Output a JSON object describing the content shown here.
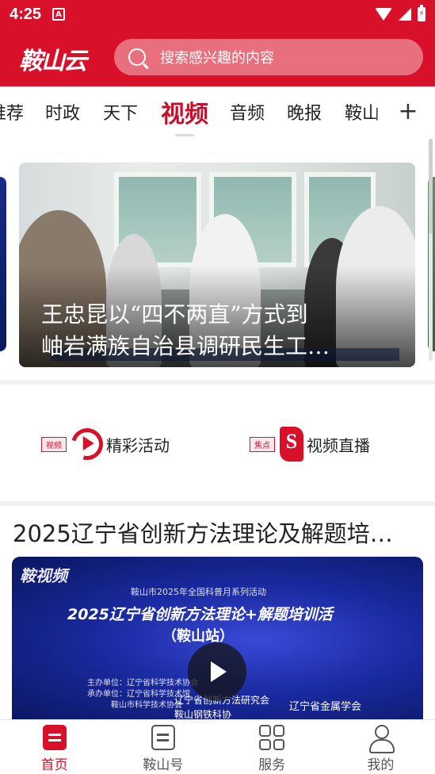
{
  "status_bar": {
    "time": "4:25"
  },
  "header": {
    "logo": "鞍山云",
    "search_placeholder": "搜索感兴趣的内容"
  },
  "tabs": [
    {
      "label": "推荐"
    },
    {
      "label": "时政"
    },
    {
      "label": "天下"
    },
    {
      "label": "视频"
    },
    {
      "label": "音频"
    },
    {
      "label": "晚报"
    },
    {
      "label": "鞍山"
    }
  ],
  "tab_more": "+",
  "hero": {
    "title_line1": "王忠昆以“四不两直”方式到",
    "title_line2": "岫岩满族自治县调研民生工…"
  },
  "quick_entries": [
    {
      "tag": "视频",
      "label": "精彩活动"
    },
    {
      "tag": "焦点",
      "label": "视频直播"
    }
  ],
  "article": {
    "title": "2025辽宁省创新方法理论及解题培…",
    "brand": "鞍视频",
    "poster_lines": [
      "鞍山市2025年全国科普月系列活动",
      "2025辽宁省创新方法理论+解题培训活",
      "（鞍山站）",
      "主办单位：辽宁省科学技术协会",
      "承办单位：辽宁省科学技术馆",
      "鞍山市科学技术协会",
      "辽宁省创新方法研究会",
      "鞍山钢铁科协",
      "辽宁省金属学会"
    ]
  },
  "bottom_nav": [
    {
      "label": "首页",
      "icon": "home-icon"
    },
    {
      "label": "鞍山号",
      "icon": "doc-icon"
    },
    {
      "label": "服务",
      "icon": "grid-icon"
    },
    {
      "label": "我的",
      "icon": "user-icon"
    }
  ],
  "colors": {
    "brand_red": "#d8102a",
    "active_tab": "#c4102a"
  }
}
